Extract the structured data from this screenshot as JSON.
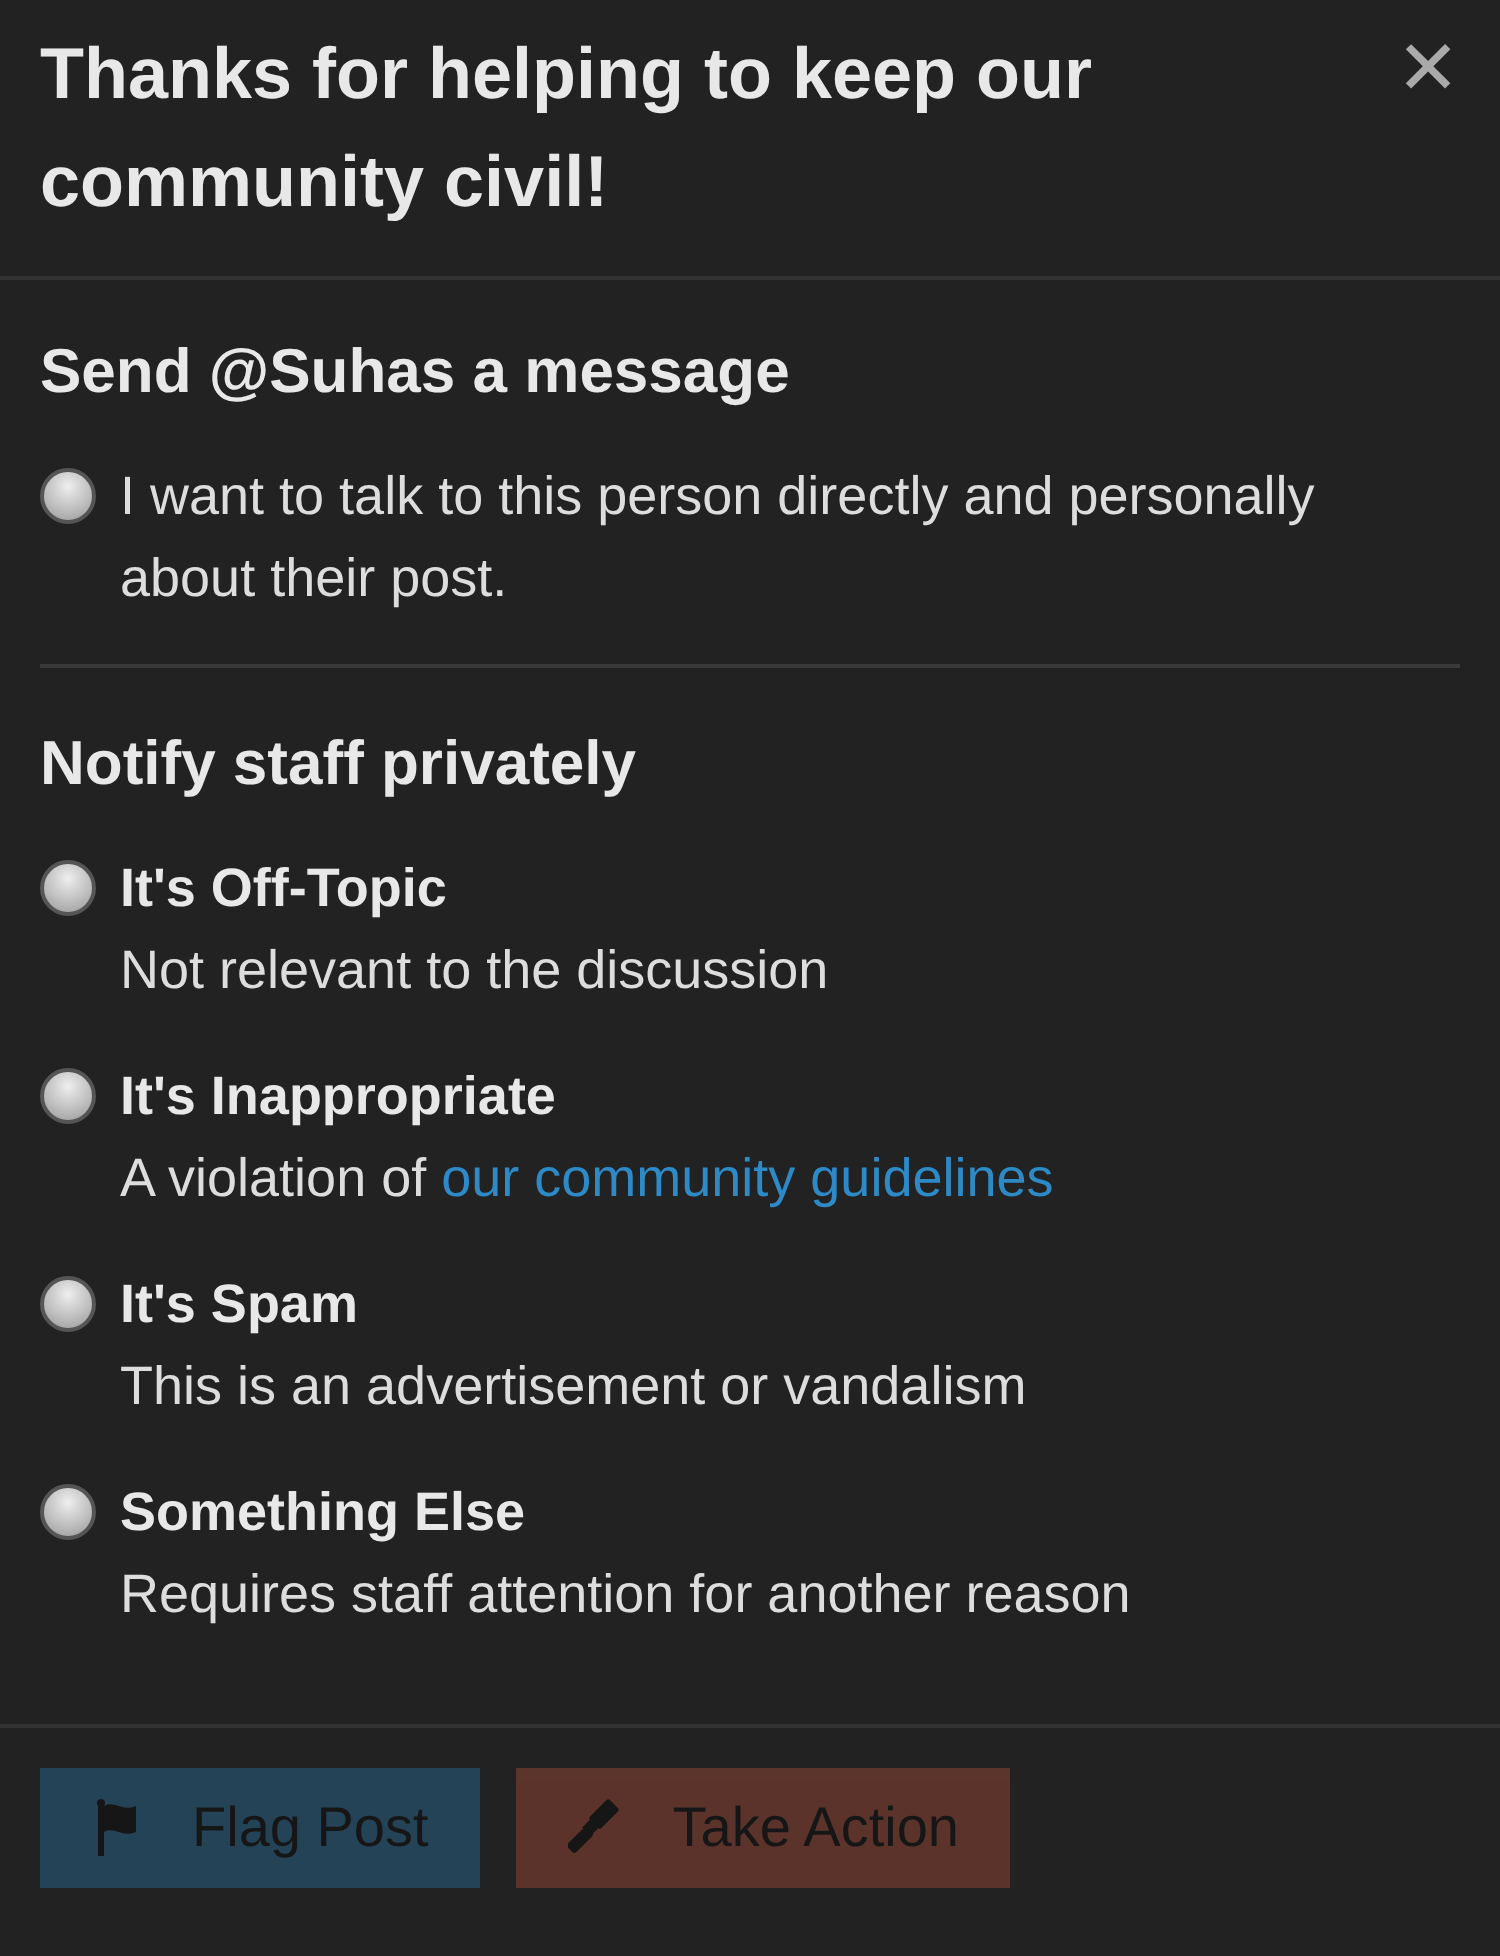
{
  "dialog": {
    "title": "Thanks for helping to keep our community civil!",
    "close": "✕"
  },
  "message_section": {
    "heading": "Send @Suhas a message",
    "options": [
      {
        "label": "I want to talk to this person directly and personally about their post.",
        "selected": false
      }
    ]
  },
  "staff_section": {
    "heading": "Notify staff privately",
    "options": [
      {
        "label": "It's Off-Topic",
        "description": "Not relevant to the discussion",
        "selected": false
      },
      {
        "label": "It's Inappropriate",
        "description": "A violation of ",
        "link": "our community guidelines",
        "selected": false
      },
      {
        "label": "It's Spam",
        "description": "This is an advertisement or vandalism",
        "selected": false
      },
      {
        "label": "Something Else",
        "description": "Requires staff attention for another reason",
        "selected": false
      }
    ]
  },
  "buttons": [
    {
      "kind": "flag",
      "label": "Flag Post",
      "disabled": true
    },
    {
      "kind": "action",
      "label": "Take Action",
      "disabled": true
    }
  ]
}
